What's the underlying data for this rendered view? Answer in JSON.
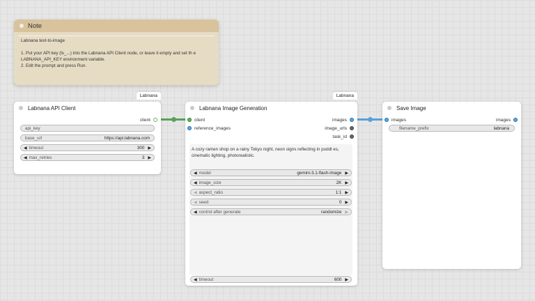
{
  "note": {
    "title": "Note",
    "body": "Labnana text-to-image\n\n1. Put your API key (ls_...) into the Labnana API Client node, or leave it empty and set th e LABNANA_API_KEY environment variable.\n2. Edit the prompt and press Run."
  },
  "client_node": {
    "badge": "Labnana",
    "title": "Labnana API Client",
    "output_label": "client",
    "widgets": {
      "api_key": {
        "label": "api_key",
        "value": ""
      },
      "base_url": {
        "label": "base_url",
        "value": "https://api.labnana.com"
      },
      "timeout": {
        "label": "timeout",
        "value": "300"
      },
      "max_retries": {
        "label": "max_retries",
        "value": "3"
      }
    }
  },
  "gen_node": {
    "badge": "Labnana",
    "title": "Labnana Image Generation",
    "inputs": {
      "client": "client",
      "reference_images": "reference_images"
    },
    "outputs": {
      "images": "images",
      "image_urls": "image_urls",
      "task_id": "task_id"
    },
    "prompt": "A cozy ramen shop on a rainy Tokyo night, neon signs reflecting in puddl es, cinematic lighting, photorealistic.",
    "widgets": {
      "model": {
        "label": "model",
        "value": "gemini-3.1-flash-image"
      },
      "image_size": {
        "label": "image_size",
        "value": "2K"
      },
      "aspect_ratio": {
        "label": "aspect_ratio",
        "value": "1:1"
      },
      "seed": {
        "label": "seed",
        "value": "0"
      },
      "control_after_generate": {
        "label": "control after generate",
        "value": "randomize"
      },
      "timeout": {
        "label": "timeout",
        "value": "600"
      }
    }
  },
  "save_node": {
    "title": "Save Image",
    "input_label": "images",
    "output_label": "images",
    "widgets": {
      "filename_prefix": {
        "label": "filename_prefix",
        "value": "labnana"
      }
    }
  },
  "colors": {
    "client_link": "#5aa05a",
    "images_link": "#5b9fd6",
    "canvas": "#e6e6e6",
    "note_header": "#d8c39d",
    "note_body": "#e6dcc4"
  }
}
